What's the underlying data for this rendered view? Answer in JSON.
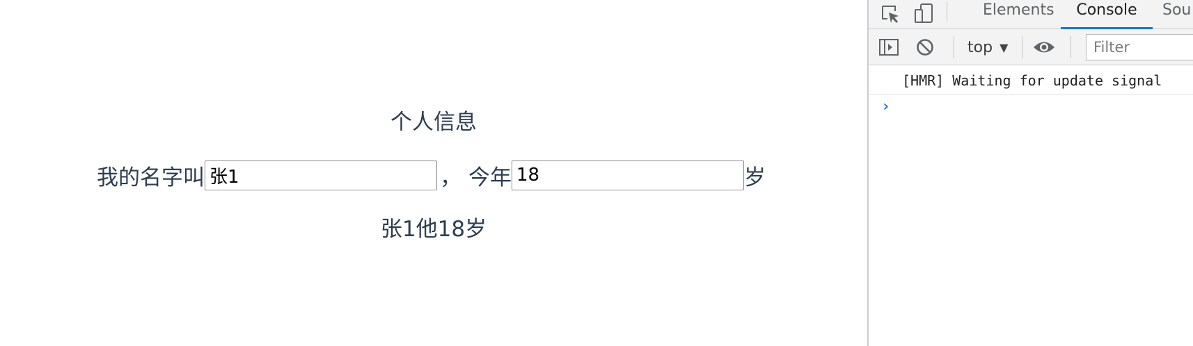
{
  "app": {
    "heading": "个人信息",
    "name_prefix": "我的名字叫",
    "name_value": "张1",
    "separator": "，",
    "age_prefix": "今年",
    "age_value": "18",
    "age_suffix": "岁",
    "summary": "张1他18岁"
  },
  "devtools": {
    "tabs": [
      "Elements",
      "Console",
      "Sou"
    ],
    "active_tab": "Console",
    "context": "top",
    "filter_placeholder": "Filter",
    "messages": [
      "[HMR] Waiting for update signal"
    ],
    "accent_color": "#1a73e8",
    "icons": [
      "inspect-element-icon",
      "device-toggle-icon",
      "sidebar-toggle-icon",
      "clear-console-icon",
      "caret-down-icon",
      "eye-icon",
      "prompt-chevron-icon"
    ]
  }
}
